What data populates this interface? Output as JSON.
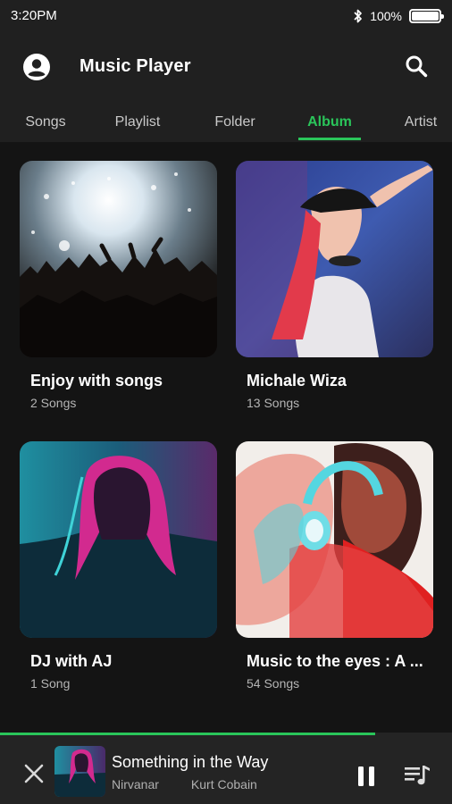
{
  "status_bar": {
    "time": "3:20PM",
    "battery_text": "100%",
    "battery_level": 1.0,
    "icons": [
      "bluetooth-icon",
      "battery-icon"
    ]
  },
  "app_bar": {
    "title": "Music Player",
    "icons": [
      "account-icon",
      "search-icon"
    ]
  },
  "tabs": [
    {
      "label": "Songs",
      "active": false
    },
    {
      "label": "Playlist",
      "active": false
    },
    {
      "label": "Folder",
      "active": false
    },
    {
      "label": "Album",
      "active": true
    },
    {
      "label": "Artist",
      "active": false
    }
  ],
  "albums": [
    {
      "title": "Enjoy with songs",
      "count": "2 Songs"
    },
    {
      "title": "Michale Wiza",
      "count": "13 Songs"
    },
    {
      "title": "DJ with AJ",
      "count": "1 Song"
    },
    {
      "title": "Music to the eyes : A ...",
      "count": "54 Songs"
    }
  ],
  "now_playing": {
    "title": "Something in the Way",
    "album": "Nirvanar",
    "artist": "Kurt Cobain",
    "progress": 0.83,
    "icons": [
      "close-icon",
      "pause-icon",
      "queue-icon"
    ]
  },
  "colors": {
    "accent": "#2ac55a",
    "background": "#141414",
    "header": "#202020",
    "player": "#242424"
  }
}
